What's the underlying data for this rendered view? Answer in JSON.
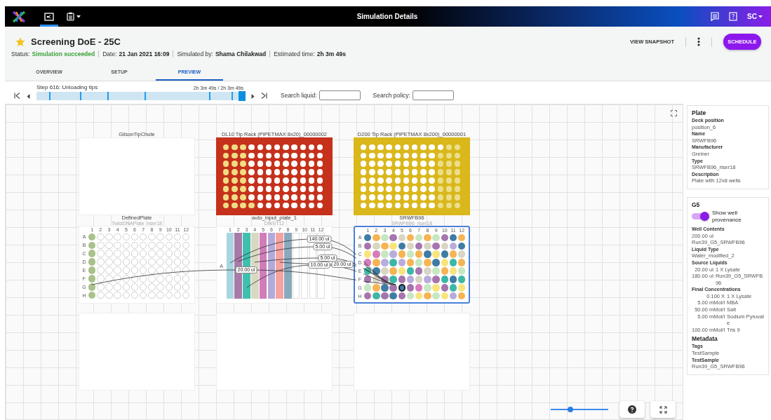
{
  "topbar": {
    "title": "Simulation Details",
    "nav": [
      {
        "kind": "deck",
        "selected": true
      },
      {
        "kind": "clipboard",
        "selected": false
      }
    ],
    "user": "SC"
  },
  "header": {
    "starred": true,
    "title": "Screening DoE - 25C",
    "status": [
      {
        "label": "Status:",
        "value": "Simulation succeeded",
        "kind": "success"
      },
      {
        "label": "Date:",
        "value": "21 Jan 2021 16:09",
        "kind": "plain"
      },
      {
        "label": "Simulated by:",
        "value": "Shama Chilakwad",
        "kind": "plain"
      },
      {
        "label": "Estimated time:",
        "value": "2h 3m 49s",
        "kind": "plain"
      }
    ],
    "snapshot": "VIEW SNAPSHOT",
    "schedule": "SCHEDULE"
  },
  "tabs": [
    {
      "label": "OVERVIEW",
      "selected": false
    },
    {
      "label": "SETUP",
      "selected": false
    },
    {
      "label": "PREVIEW",
      "selected": true
    }
  ],
  "timeline": {
    "step": "Step 616: Unloading tips",
    "time": "2h 3m 49s / 2h 3m 49s",
    "level": 1,
    "markers": [
      {
        "level": 0.06
      },
      {
        "level": 0.21
      },
      {
        "level": 0.34
      },
      {
        "level": 0.52
      },
      {
        "level": 0.83
      },
      {
        "level": 0.94
      }
    ],
    "search_fields": [
      {
        "label": "Search liquid:"
      },
      {
        "label": "Search policy:"
      }
    ]
  },
  "deck": {
    "plates": [
      {
        "kind": "chute",
        "label": "GilsonTipChute",
        "selected": false
      },
      {
        "kind": "tiprack",
        "label": "DL10 Tip Rack (PIPETMAX 8x20)_00000002",
        "color": "#c5311b",
        "selected": false,
        "rows": [
          {
            "present": [
              false,
              false,
              false,
              true,
              true,
              true,
              true,
              true,
              true,
              true,
              true,
              true
            ]
          },
          {
            "present": [
              false,
              false,
              false,
              true,
              true,
              true,
              true,
              true,
              true,
              true,
              true,
              true
            ]
          },
          {
            "present": [
              false,
              false,
              false,
              true,
              true,
              true,
              true,
              true,
              true,
              true,
              true,
              true
            ]
          },
          {
            "present": [
              false,
              false,
              false,
              true,
              true,
              true,
              true,
              true,
              true,
              true,
              true,
              true
            ]
          },
          {
            "present": [
              false,
              false,
              false,
              true,
              true,
              true,
              true,
              true,
              true,
              true,
              true,
              true
            ]
          },
          {
            "present": [
              false,
              false,
              false,
              true,
              true,
              true,
              true,
              true,
              true,
              true,
              true,
              true
            ]
          },
          {
            "present": [
              false,
              false,
              false,
              true,
              true,
              true,
              true,
              true,
              true,
              true,
              true,
              true
            ]
          },
          {
            "present": [
              false,
              false,
              false,
              false,
              true,
              true,
              true,
              true,
              true,
              true,
              true,
              true
            ]
          }
        ]
      },
      {
        "kind": "tiprack",
        "label": "D200 Tip Rack (PIPETMAX 8x200)_00000001",
        "color": "#dab71b",
        "selected": false,
        "rows": [
          {
            "present": [
              true,
              true,
              true,
              true,
              true,
              true,
              true,
              true,
              true,
              true,
              false,
              false
            ]
          },
          {
            "present": [
              true,
              true,
              true,
              true,
              true,
              true,
              true,
              true,
              true,
              false,
              false,
              false
            ]
          },
          {
            "present": [
              true,
              true,
              true,
              true,
              true,
              true,
              true,
              true,
              true,
              false,
              false,
              false
            ]
          },
          {
            "present": [
              true,
              true,
              true,
              true,
              true,
              true,
              true,
              true,
              true,
              false,
              false,
              false
            ]
          },
          {
            "present": [
              true,
              true,
              true,
              true,
              true,
              true,
              true,
              true,
              true,
              false,
              false,
              false
            ]
          },
          {
            "present": [
              true,
              true,
              true,
              true,
              true,
              true,
              true,
              true,
              true,
              false,
              false,
              false
            ]
          },
          {
            "present": [
              true,
              true,
              true,
              true,
              true,
              true,
              true,
              true,
              true,
              false,
              false,
              false
            ]
          },
          {
            "present": [
              true,
              true,
              true,
              true,
              true,
              true,
              true,
              true,
              true,
              false,
              false,
              false
            ]
          }
        ]
      },
      {
        "kind": "plate",
        "label": "DefinedPlate",
        "sublabel": "TwistDNAPlate_riser18",
        "selected": false,
        "columns": [
          "1",
          "2",
          "3",
          "4",
          "5",
          "6",
          "7",
          "8",
          "9",
          "10",
          "11",
          "12"
        ],
        "rows": [
          {
            "label": "A",
            "wells": [
              {
                "color": "#a8c28a",
                "selected": false
              },
              {
                "selected": false
              },
              {
                "selected": false
              },
              {
                "selected": false
              },
              {
                "selected": false
              },
              {
                "selected": false
              },
              {
                "selected": false
              },
              {
                "selected": false
              },
              {
                "selected": false
              },
              {
                "selected": false
              },
              {
                "selected": false
              },
              {
                "selected": false
              }
            ]
          },
          {
            "label": "B",
            "wells": [
              {
                "color": "#a8c28a",
                "selected": false
              },
              {
                "selected": false
              },
              {
                "selected": false
              },
              {
                "selected": false
              },
              {
                "selected": false
              },
              {
                "selected": false
              },
              {
                "selected": false
              },
              {
                "selected": false
              },
              {
                "selected": false
              },
              {
                "selected": false
              },
              {
                "selected": false
              },
              {
                "selected": false
              }
            ]
          },
          {
            "label": "C",
            "wells": [
              {
                "color": "#a8c28a",
                "selected": false
              },
              {
                "selected": false
              },
              {
                "selected": false
              },
              {
                "selected": false
              },
              {
                "selected": false
              },
              {
                "selected": false
              },
              {
                "selected": false
              },
              {
                "selected": false
              },
              {
                "selected": false
              },
              {
                "selected": false
              },
              {
                "selected": false
              },
              {
                "selected": false
              }
            ]
          },
          {
            "label": "D",
            "wells": [
              {
                "color": "#a8c28a",
                "selected": false
              },
              {
                "selected": false
              },
              {
                "selected": false
              },
              {
                "selected": false
              },
              {
                "selected": false
              },
              {
                "selected": false
              },
              {
                "selected": false
              },
              {
                "selected": false
              },
              {
                "selected": false
              },
              {
                "selected": false
              },
              {
                "selected": false
              },
              {
                "selected": false
              }
            ]
          },
          {
            "label": "E",
            "wells": [
              {
                "color": "#a8c28a",
                "selected": false
              },
              {
                "selected": false
              },
              {
                "selected": false
              },
              {
                "selected": false
              },
              {
                "selected": false
              },
              {
                "selected": false
              },
              {
                "selected": false
              },
              {
                "selected": false
              },
              {
                "selected": false
              },
              {
                "selected": false
              },
              {
                "selected": false
              },
              {
                "selected": false
              }
            ]
          },
          {
            "label": "F",
            "wells": [
              {
                "color": "#a8c28a",
                "selected": false
              },
              {
                "selected": false
              },
              {
                "selected": false
              },
              {
                "selected": false
              },
              {
                "selected": false
              },
              {
                "selected": false
              },
              {
                "selected": false
              },
              {
                "selected": false
              },
              {
                "selected": false
              },
              {
                "selected": false
              },
              {
                "selected": false
              },
              {
                "selected": false
              }
            ]
          },
          {
            "label": "G",
            "wells": [
              {
                "color": "#a8c28a",
                "selected": false
              },
              {
                "selected": false
              },
              {
                "selected": false
              },
              {
                "selected": false
              },
              {
                "selected": false
              },
              {
                "selected": false
              },
              {
                "selected": false
              },
              {
                "selected": false
              },
              {
                "selected": false
              },
              {
                "selected": false
              },
              {
                "selected": false
              },
              {
                "selected": false
              }
            ]
          },
          {
            "label": "H",
            "wells": [
              {
                "color": "#a8c28a",
                "selected": false
              },
              {
                "selected": false
              },
              {
                "selected": false
              },
              {
                "selected": false
              },
              {
                "selected": false
              },
              {
                "selected": false
              },
              {
                "selected": false
              },
              {
                "selected": false
              },
              {
                "selected": false
              },
              {
                "selected": false
              },
              {
                "selected": false
              },
              {
                "selected": false
              }
            ]
          }
        ]
      },
      {
        "kind": "trough",
        "label": "auto_input_plate_1",
        "sublabel": "DWST12",
        "selected": false,
        "row_label": "A",
        "columns": [
          {
            "label": "1",
            "color": "#a9d5e0"
          },
          {
            "label": "2",
            "color": "#a87aa8"
          },
          {
            "label": "3",
            "color": "#3fbfae"
          },
          {
            "label": "4",
            "color": "#d9d9c2"
          },
          {
            "label": "5",
            "color": "#d27cba"
          },
          {
            "label": "6",
            "color": "#b2aadb"
          },
          {
            "label": "7",
            "color": "#f5a3a0"
          },
          {
            "label": "8",
            "color": "#8aa9bd"
          },
          {
            "label": "9"
          },
          {
            "label": "10"
          },
          {
            "label": "11"
          },
          {
            "label": "12"
          }
        ]
      },
      {
        "kind": "plate",
        "label": "SRWFB96",
        "sublabel": "SRWFB96_riser18",
        "selected": true,
        "columns": [
          "1",
          "2",
          "3",
          "4",
          "5",
          "6",
          "7",
          "8",
          "9",
          "10",
          "11",
          "12"
        ],
        "rows": [
          {
            "label": "A",
            "wells": [
              {
                "color": "#3e7ca5",
                "selected": false
              },
              {
                "color": "#f6b455",
                "selected": false
              },
              {
                "color": "#c6e7c1",
                "selected": false
              },
              {
                "color": "#a675ad",
                "selected": false
              },
              {
                "color": "#d8d5c4",
                "selected": false
              },
              {
                "color": "#f6b455",
                "selected": false
              },
              {
                "color": "#c6e7c1",
                "selected": false
              },
              {
                "color": "#f6b455",
                "selected": false
              },
              {
                "color": "#c6e7c1",
                "selected": false
              },
              {
                "color": "#a675ad",
                "selected": false
              },
              {
                "color": "#3e7ca5",
                "selected": false
              },
              {
                "color": "#f6b455",
                "selected": false
              }
            ]
          },
          {
            "label": "B",
            "wells": [
              {
                "color": "#a675ad",
                "selected": false
              },
              {
                "color": "#d8d5c4",
                "selected": false
              },
              {
                "color": "#f6b455",
                "selected": false
              },
              {
                "color": "#f8e47c",
                "selected": false
              },
              {
                "color": "#3e7ca5",
                "selected": false
              },
              {
                "color": "#d8d5c4",
                "selected": false
              },
              {
                "color": "#a675ad",
                "selected": false
              },
              {
                "color": "#d8d5c4",
                "selected": false
              },
              {
                "color": "#a675ad",
                "selected": false
              },
              {
                "color": "#d8d5c4",
                "selected": false
              },
              {
                "color": "#b8acdc",
                "selected": false
              },
              {
                "color": "#3e7ca5",
                "selected": false
              }
            ]
          },
          {
            "label": "C",
            "wells": [
              {
                "color": "#f8e47c",
                "selected": false
              },
              {
                "color": "#d87bbb",
                "selected": false
              },
              {
                "color": "#c6e7c1",
                "selected": false
              },
              {
                "color": "#b8acdc",
                "selected": false
              },
              {
                "color": "#f6b455",
                "selected": false
              },
              {
                "color": "#c6e7c1",
                "selected": false
              },
              {
                "color": "#f6b455",
                "selected": false
              },
              {
                "color": "#3e7ca5",
                "selected": false
              },
              {
                "color": "#f8e47c",
                "selected": false
              },
              {
                "color": "#3e7ca5",
                "selected": false
              },
              {
                "color": "#f6b455",
                "selected": false
              },
              {
                "color": "#d8d5c4",
                "selected": false
              }
            ]
          },
          {
            "label": "D",
            "wells": [
              {
                "color": "#d87bbb",
                "selected": false
              },
              {
                "color": "#f6b455",
                "selected": false
              },
              {
                "color": "#b8acdc",
                "selected": false
              },
              {
                "color": "#3cb7a6",
                "selected": false
              },
              {
                "color": "#b8acdc",
                "selected": false
              },
              {
                "color": "#f6b455",
                "selected": false
              },
              {
                "color": "#c6e7c1",
                "selected": false
              },
              {
                "color": "#f6b455",
                "selected": false
              },
              {
                "color": "#3e7ca5",
                "selected": false
              },
              {
                "color": "#f8e47c",
                "selected": false
              },
              {
                "color": "#3cb7a6",
                "selected": false
              },
              {
                "color": "#f6b455",
                "selected": false
              }
            ]
          },
          {
            "label": "E",
            "wells": [
              {
                "color": "#3cb7a6",
                "selected": false
              },
              {
                "color": "#3e7ca5",
                "selected": false
              },
              {
                "color": "#d8d5c4",
                "selected": false
              },
              {
                "color": "#f6b455",
                "selected": false
              },
              {
                "color": "#f8e47c",
                "selected": false
              },
              {
                "color": "#3cb7a6",
                "selected": false
              },
              {
                "color": "#a675ad",
                "selected": false
              },
              {
                "color": "#d8d5c4",
                "selected": false
              },
              {
                "color": "#c6e7c1",
                "selected": false
              },
              {
                "color": "#f6b455",
                "selected": false
              },
              {
                "color": "#f8e47c",
                "selected": false
              },
              {
                "color": "#c6e7c1",
                "selected": false
              }
            ]
          },
          {
            "label": "F",
            "wells": [
              {
                "color": "#a675ad",
                "selected": false
              },
              {
                "color": "#d8d5c4",
                "selected": false
              },
              {
                "color": "#a675ad",
                "selected": false
              },
              {
                "color": "#3cb7a6",
                "selected": false
              },
              {
                "color": "#a675ad",
                "selected": false
              },
              {
                "color": "#b8acdc",
                "selected": false
              },
              {
                "color": "#d8d5c4",
                "selected": false
              },
              {
                "color": "#b8acdc",
                "selected": false
              },
              {
                "color": "#a675ad",
                "selected": false
              },
              {
                "color": "#3cb7a6",
                "selected": false
              },
              {
                "color": "#3e7ca5",
                "selected": false
              },
              {
                "color": "#3cb7a6",
                "selected": false
              }
            ]
          },
          {
            "label": "G",
            "wells": [
              {
                "color": "#c6e7c1",
                "selected": false
              },
              {
                "color": "#f6b455",
                "selected": false
              },
              {
                "color": "#3e7ca5",
                "selected": false
              },
              {
                "color": "#a675ad",
                "selected": false
              },
              {
                "color": "#3e7ca5",
                "selected": true
              },
              {
                "color": "#a675ad",
                "selected": false
              },
              {
                "color": "#d87bbb",
                "selected": false
              },
              {
                "color": "#c6e7c1",
                "selected": false
              },
              {
                "color": "#f8e47c",
                "selected": false
              },
              {
                "color": "#a675ad",
                "selected": false
              },
              {
                "color": "#3cb7a6",
                "selected": false
              },
              {
                "color": "#f8e47c",
                "selected": false
              }
            ]
          },
          {
            "label": "H",
            "wells": [
              {
                "color": "#a675ad",
                "selected": false
              },
              {
                "color": "#3cb7a6",
                "selected": false
              },
              {
                "color": "#a675ad",
                "selected": false
              },
              {
                "color": "#3e7ca5",
                "selected": false
              },
              {
                "color": "#a675ad",
                "selected": false
              },
              {
                "color": "#c6e7c1",
                "selected": false
              },
              {
                "color": "#f8e47c",
                "selected": false
              },
              {
                "color": "#f6b455",
                "selected": false
              },
              {
                "color": "#c6e7c1",
                "selected": false
              },
              {
                "color": "#f8e47c",
                "selected": false
              },
              {
                "color": "#b8acdc",
                "selected": false
              },
              {
                "color": "#f6b455",
                "selected": false
              }
            ]
          }
        ]
      },
      {
        "kind": "slot",
        "selected": false
      },
      {
        "kind": "slot",
        "selected": false
      },
      {
        "kind": "slot",
        "selected": false
      }
    ],
    "transfers": [
      {
        "volume": "140.00 ul"
      },
      {
        "volume": "5.00 ul"
      },
      {
        "volume": "5.00 ul"
      },
      {
        "volume": "20.00 ul"
      },
      {
        "volume": "10.00 ul"
      },
      {
        "volume": "20.00 ul"
      }
    ],
    "zoom": {
      "level": 0.32
    }
  },
  "plate_info": {
    "title": "Plate",
    "fields": [
      {
        "label": "Deck position",
        "value": "position_6"
      },
      {
        "label": "Name",
        "value": "SRWFB96"
      },
      {
        "label": "Manufacturer",
        "value": "Greiner"
      },
      {
        "label": "Type",
        "value": "SRWFB96_riser18"
      },
      {
        "label": "Description",
        "value": "Plate with 12x8 wells"
      }
    ]
  },
  "well_info": {
    "title": "G5",
    "provenance": {
      "label": "Show well provenance",
      "on": true
    },
    "sections": [
      {
        "label": "Well Contents",
        "lines": [
          "200.00 ul",
          "Run39_G5_SRWFB96"
        ]
      },
      {
        "label": "Liquid Type",
        "lines": [
          "Water_modified_2"
        ]
      },
      {
        "label": "Source Liquids",
        "entries": [
          {
            "amount": "20.00 ul",
            "name": "1 X Lysate"
          },
          {
            "amount": "180.00 ul",
            "name": "Run39_G5_SRWFB96"
          }
        ]
      },
      {
        "label": "Final Concentrations",
        "entries": [
          {
            "amount": "0.100 X",
            "name": "1 X Lysate"
          },
          {
            "amount": "5.00 mMol/l",
            "name": "MBA"
          },
          {
            "amount": "50.00 mMol/l",
            "name": "Salt"
          },
          {
            "amount": "5.00 mMol/l",
            "name": "Sodium Pyruvate"
          },
          {
            "amount": "100.00 mMol/l",
            "name": "Tris 9"
          }
        ]
      }
    ],
    "metadata": {
      "title": "Metadata",
      "fields": [
        {
          "label": "Tags",
          "value": "TestSample"
        },
        {
          "label": "TestSample",
          "value": "Run39_G5_SRWFB96"
        }
      ]
    }
  }
}
